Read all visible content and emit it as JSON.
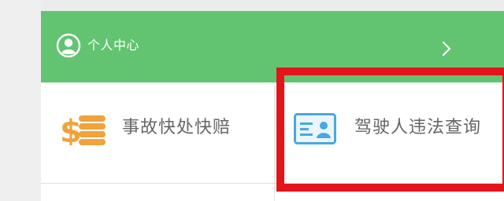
{
  "header": {
    "personal_center_label": "个人中心",
    "avatar_icon": "user-circle-icon",
    "arrow_icon": "chevron-right-icon",
    "bar_color": "#62c370"
  },
  "menu": {
    "items": [
      {
        "label": "事故快处快赔",
        "icon": "coin-stack-icon",
        "icon_color": "#f0a33a"
      },
      {
        "label": "驾驶人违法查询",
        "icon": "id-card-icon",
        "icon_color": "#4aa8df",
        "highlighted": true,
        "highlight_color": "#e4141b"
      }
    ]
  }
}
